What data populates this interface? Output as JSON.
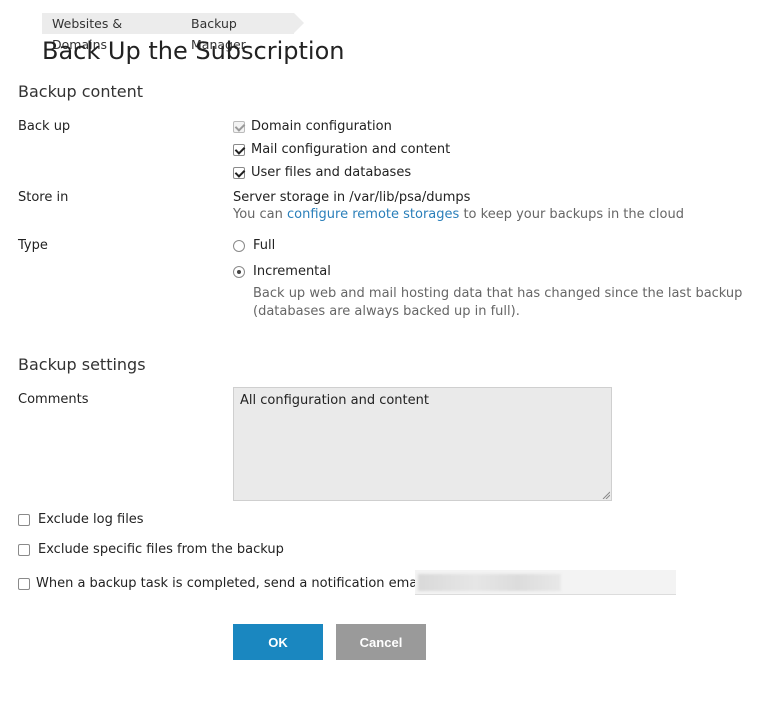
{
  "breadcrumb": {
    "items": [
      "Websites & Domains",
      "Backup Manager"
    ]
  },
  "page": {
    "title": "Back Up the Subscription"
  },
  "backup_content": {
    "heading": "Backup content",
    "backup_label": "Back up",
    "options": [
      {
        "label": "Domain configuration",
        "checked": true,
        "disabled": true
      },
      {
        "label": "Mail configuration and content",
        "checked": true,
        "disabled": false
      },
      {
        "label": "User files and databases",
        "checked": true,
        "disabled": false
      }
    ],
    "store_label": "Store in",
    "store_value": "Server storage in /var/lib/psa/dumps",
    "store_hint_before": "You can ",
    "store_hint_link": "configure remote storages",
    "store_hint_after": " to keep your backups in the cloud",
    "type_label": "Type",
    "types": [
      {
        "label": "Full",
        "selected": false
      },
      {
        "label": "Incremental",
        "selected": true
      }
    ],
    "incremental_hint_line1": "Back up web and mail hosting data that has changed since the last backup",
    "incremental_hint_line2": "(databases are always backed up in full)."
  },
  "backup_settings": {
    "heading": "Backup settings",
    "comments_label": "Comments",
    "comments_value": "All configuration and content",
    "exclude_log": {
      "label": "Exclude log files",
      "checked": false
    },
    "exclude_specific": {
      "label": "Exclude specific files from the backup",
      "checked": false
    },
    "notify": {
      "label": "When a backup task is completed, send a notification email to",
      "checked": false
    }
  },
  "buttons": {
    "ok": "OK",
    "cancel": "Cancel"
  },
  "colors": {
    "accent": "#1a87c0",
    "link": "#2a7fba",
    "cancel": "#9a9a9a"
  }
}
